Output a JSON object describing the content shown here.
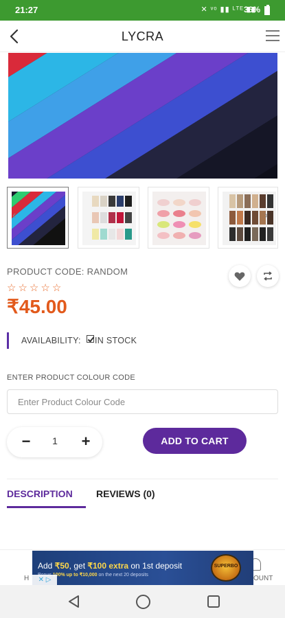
{
  "status_bar": {
    "time": "21:27",
    "icons": "✕ ᵛᵒ ▮▮ ᴸᵀᴱ ▮▮",
    "battery": "36%"
  },
  "header": {
    "title": "LYCRA"
  },
  "product": {
    "code_label": "PRODUCT CODE: RANDOM",
    "rating": 0,
    "stars": [
      "☆",
      "☆",
      "☆",
      "☆",
      "☆"
    ],
    "price": "₹45.00",
    "availability_label": "AVAILABILITY:",
    "availability_value": "IN STOCK"
  },
  "colour_code": {
    "label": "ENTER PRODUCT COLOUR CODE",
    "placeholder": "Enter Product Colour Code",
    "value": ""
  },
  "quantity": {
    "minus": "−",
    "value": "1",
    "plus": "+"
  },
  "cart": {
    "add_label": "ADD TO CART"
  },
  "tabs": [
    {
      "label": "DESCRIPTION",
      "active": true
    },
    {
      "label": "REVIEWS (0)",
      "active": false
    }
  ],
  "bottom_nav": {
    "left_fragment": "H",
    "right_fragment": "OUNT"
  },
  "ad": {
    "headline_pre": "Add ",
    "headline_amount1": "₹50",
    "headline_mid": ", get ",
    "headline_amount2": "₹100 extra",
    "headline_post": " on 1st deposit",
    "sub_pre": "Bonus ",
    "sub_bold": "100% up to ₹10,000",
    "sub_post": " on the next 20 deposits",
    "badge": "SUPERBO"
  },
  "colors": {
    "accent": "#5d2a9c",
    "price": "#e25a1c",
    "status_bar": "#3d9a30",
    "star": "#e86a2a"
  }
}
